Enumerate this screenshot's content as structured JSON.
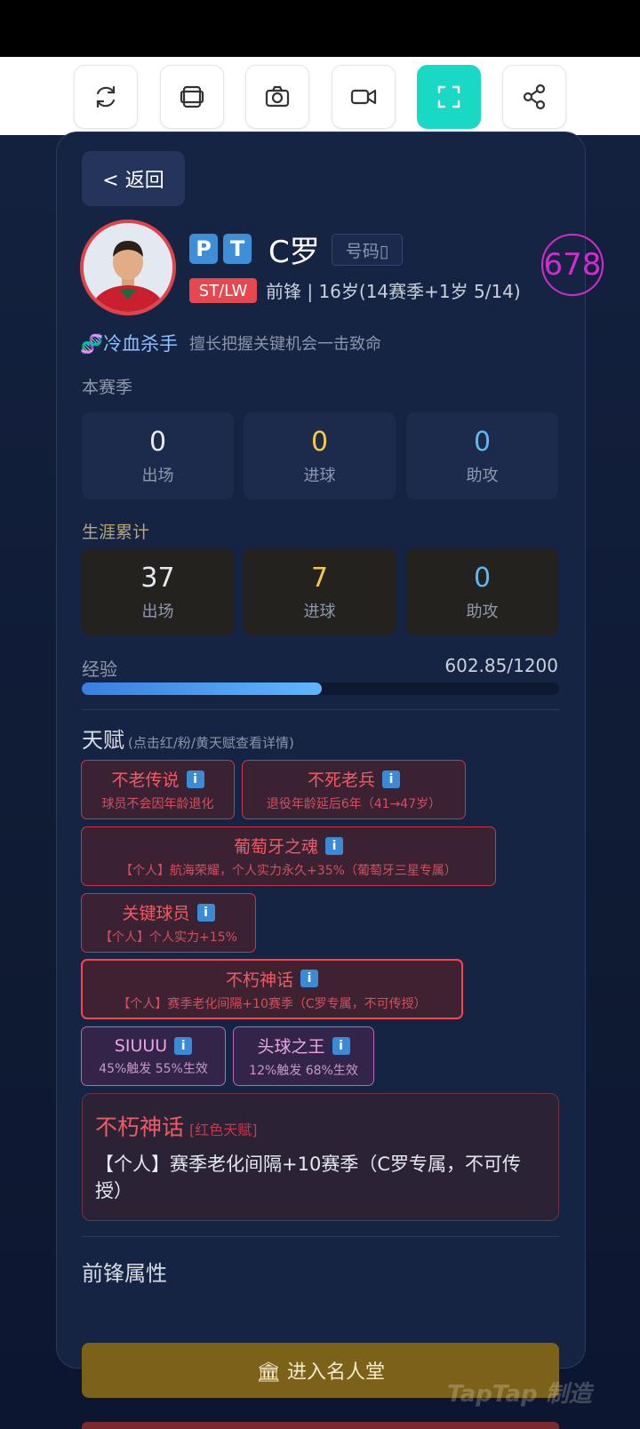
{
  "toolbar": {
    "buttons": [
      {
        "icon": "refresh-icon"
      },
      {
        "icon": "layers-icon"
      },
      {
        "icon": "camera-icon"
      },
      {
        "icon": "video-icon"
      },
      {
        "icon": "fullscreen-icon",
        "active": true
      },
      {
        "icon": "share-icon"
      }
    ]
  },
  "header": {
    "back_label": "< 返回",
    "badge_p": "P",
    "badge_t": "T",
    "player_name": "C罗",
    "number_label": "号码▯",
    "position_badge": "ST/LW",
    "role_age": "前锋 | 16岁(14赛季+1岁 5/14)",
    "rating": "678"
  },
  "trait": {
    "name": "🧬冷血杀手",
    "description": "擅长把握关键机会一击致命"
  },
  "season": {
    "label": "本赛季",
    "stats": [
      {
        "value": "0",
        "label": "出场"
      },
      {
        "value": "0",
        "label": "进球"
      },
      {
        "value": "0",
        "label": "助攻"
      }
    ]
  },
  "career": {
    "label": "生涯累计",
    "stats": [
      {
        "value": "37",
        "label": "出场"
      },
      {
        "value": "7",
        "label": "进球"
      },
      {
        "value": "0",
        "label": "助攻"
      }
    ]
  },
  "experience": {
    "label": "经验",
    "value_text": "602.85/1200",
    "progress": 0.5024
  },
  "talents": {
    "title": "天赋",
    "hint": "(点击红/粉/黄天赋查看详情)",
    "info_glyph": "i",
    "items": [
      {
        "name": "不老传说",
        "desc": "球员不会因年龄退化"
      },
      {
        "name": "不死老兵",
        "desc": "退役年龄延后6年（41→47岁）"
      },
      {
        "name": "葡萄牙之魂",
        "desc": "【个人】航海荣耀，个人实力永久+35%（葡萄牙三星专属）"
      },
      {
        "name": "关键球员",
        "desc": "【个人】个人实力+15%"
      },
      {
        "name": "不朽神话",
        "desc": "【个人】赛季老化间隔+10赛季（C罗专属，不可传授）"
      },
      {
        "name": "SIUUU",
        "desc": "45%触发 55%生效"
      },
      {
        "name": "头球之王",
        "desc": "12%触发 68%生效"
      }
    ]
  },
  "detail": {
    "title": "不朽神话",
    "kind": "[红色天赋]",
    "body": "【个人】赛季老化间隔+10赛季（C罗专属，不可传授）"
  },
  "attributes": {
    "title": "前锋属性"
  },
  "hall_button": {
    "label": "🏛 进入名人堂"
  },
  "watermark": "TapTap 制造",
  "colors": {
    "accent": "#1ad9c4",
    "red_talent": "#f25a64",
    "pink_talent": "#e8a6e6",
    "rating": "#d22ccf",
    "goals": "#f5c84a",
    "assists": "#5ab8f5"
  }
}
